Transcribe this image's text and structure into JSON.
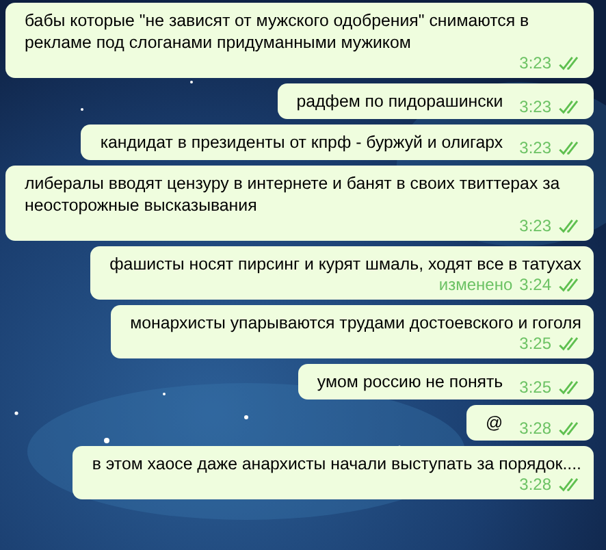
{
  "messages": [
    {
      "text": "бабы которые \"не зависят от мужского одобрения\" снимаются в рекламе под слоганами придуманными мужиком",
      "time": "3:23",
      "read": true,
      "kind": "block",
      "tail": false
    },
    {
      "text": "радфем по пидорашински",
      "time": "3:23",
      "read": true,
      "kind": "inline",
      "tail": false
    },
    {
      "text": "кандидат в президенты от кпрф - буржуй и олигарх",
      "time": "3:23",
      "read": true,
      "kind": "inline",
      "tail": false
    },
    {
      "text": "либералы вводят цензуру в интернете и банят в своих твиттерах за неосторожные высказывания",
      "time": "3:23",
      "read": true,
      "kind": "block",
      "tail": false
    },
    {
      "text": "фашисты носят пирсинг и курят шмаль, ходят все в татухах",
      "edited": "изменено",
      "time": "3:24",
      "read": true,
      "kind": "block",
      "tail": false
    },
    {
      "text": "монархисты упарываются трудами достоевского и гоголя",
      "time": "3:25",
      "read": true,
      "kind": "block",
      "tail": false
    },
    {
      "text": "умом россию не понять",
      "time": "3:25",
      "read": true,
      "kind": "inline",
      "tail": false
    },
    {
      "text": "@",
      "time": "3:28",
      "read": true,
      "kind": "inline",
      "tail": false
    },
    {
      "text": "в этом хаосе даже анархисты начали выступать за порядок....",
      "time": "3:28",
      "read": true,
      "kind": "block",
      "tail": true
    }
  ]
}
